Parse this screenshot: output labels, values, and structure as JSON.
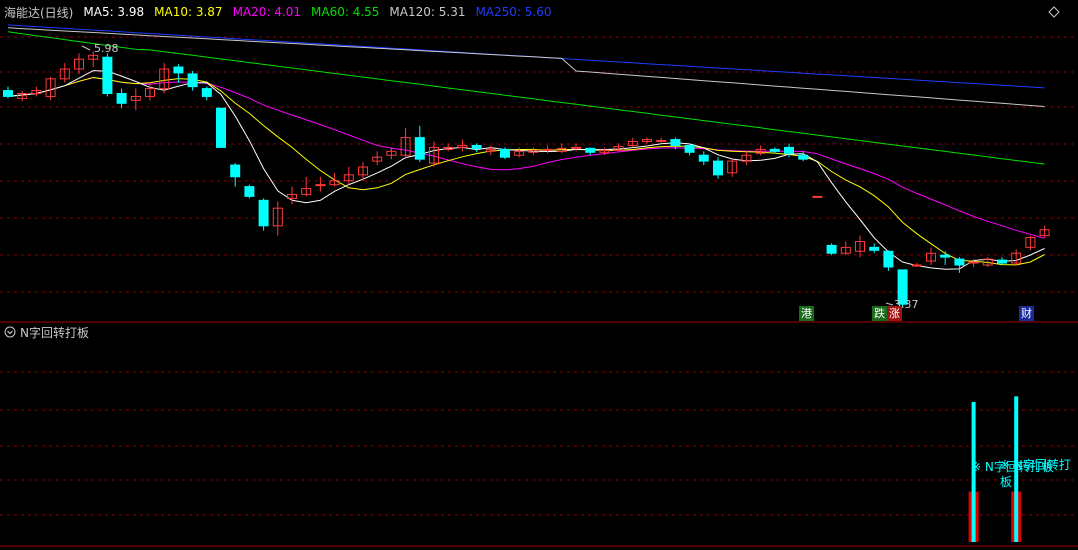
{
  "legend": {
    "title": "海能达(日线)",
    "items": [
      {
        "label": "MA5: 3.98",
        "color": "#ffffff"
      },
      {
        "label": "MA10: 3.87",
        "color": "#ffff00"
      },
      {
        "label": "MA20: 4.01",
        "color": "#ff00ff"
      },
      {
        "label": "MA60: 4.55",
        "color": "#00e000"
      },
      {
        "label": "MA120: 5.31",
        "color": "#c8c8c8"
      },
      {
        "label": "MA250: 5.60",
        "color": "#1e3cff"
      }
    ]
  },
  "annotations": {
    "high_label": "5.98",
    "low_label": "3.37"
  },
  "badges": [
    {
      "text": "港",
      "color": "#1a6b1a"
    },
    {
      "text": "跌",
      "color": "#1a6b1a"
    },
    {
      "text": "涨",
      "color": "#a01010"
    },
    {
      "text": "财",
      "color": "#1a2a9a"
    }
  ],
  "sub_panel": {
    "title": "N字回转打板",
    "signal_label": "※ N字回转打板",
    "signal_label_2": "※ N字回转打板"
  },
  "colors": {
    "up": "#ff3a3a",
    "down": "#00ffff",
    "grid": "#8b0000",
    "ma5": "#ffffff",
    "ma10": "#ffff00",
    "ma20": "#ff00ff",
    "ma60": "#00e000",
    "ma120": "#c8c8c8",
    "ma250": "#1e3cff"
  },
  "chart_data": {
    "type": "candlestick",
    "price_range": [
      3.3,
      6.3
    ],
    "candles": [
      [
        5.58,
        5.52,
        5.62,
        5.5
      ],
      [
        5.5,
        5.55,
        5.58,
        5.47
      ],
      [
        5.55,
        5.58,
        5.62,
        5.52
      ],
      [
        5.52,
        5.7,
        5.72,
        5.48
      ],
      [
        5.7,
        5.8,
        5.86,
        5.66
      ],
      [
        5.8,
        5.9,
        5.96,
        5.75
      ],
      [
        5.9,
        5.94,
        5.98,
        5.82
      ],
      [
        5.92,
        5.55,
        5.96,
        5.52
      ],
      [
        5.55,
        5.45,
        5.6,
        5.4
      ],
      [
        5.48,
        5.52,
        5.6,
        5.38
      ],
      [
        5.52,
        5.6,
        5.66,
        5.48
      ],
      [
        5.6,
        5.8,
        5.86,
        5.55
      ],
      [
        5.82,
        5.76,
        5.85,
        5.66
      ],
      [
        5.75,
        5.62,
        5.78,
        5.58
      ],
      [
        5.6,
        5.52,
        5.62,
        5.48
      ],
      [
        5.4,
        5.0,
        5.4,
        5.0
      ],
      [
        4.82,
        4.7,
        4.84,
        4.6
      ],
      [
        4.6,
        4.5,
        4.62,
        4.48
      ],
      [
        4.46,
        4.2,
        4.48,
        4.15
      ],
      [
        4.2,
        4.38,
        4.45,
        4.1
      ],
      [
        4.48,
        4.52,
        4.6,
        4.42
      ],
      [
        4.52,
        4.58,
        4.7,
        4.5
      ],
      [
        4.62,
        4.62,
        4.7,
        4.55
      ],
      [
        4.62,
        4.66,
        4.74,
        4.6
      ],
      [
        4.66,
        4.72,
        4.8,
        4.62
      ],
      [
        4.72,
        4.8,
        4.85,
        4.66
      ],
      [
        4.86,
        4.9,
        4.96,
        4.82
      ],
      [
        4.92,
        4.96,
        5.0,
        4.88
      ],
      [
        4.92,
        5.1,
        5.2,
        4.88
      ],
      [
        5.1,
        4.88,
        5.22,
        4.85
      ],
      [
        4.84,
        5.0,
        5.06,
        4.8
      ],
      [
        4.98,
        5.0,
        5.04,
        4.96
      ],
      [
        5.0,
        5.02,
        5.08,
        4.96
      ],
      [
        5.02,
        4.99,
        5.04,
        4.95
      ],
      [
        4.96,
        4.98,
        5.02,
        4.92
      ],
      [
        4.98,
        4.9,
        5.0,
        4.88
      ],
      [
        4.92,
        4.96,
        5.0,
        4.9
      ],
      [
        4.95,
        4.97,
        5.0,
        4.92
      ],
      [
        4.97,
        4.98,
        5.02,
        4.94
      ],
      [
        4.96,
        4.99,
        5.04,
        4.94
      ],
      [
        5.0,
        5.0,
        5.04,
        4.96
      ],
      [
        4.99,
        4.95,
        5.0,
        4.92
      ],
      [
        4.95,
        4.97,
        5.0,
        4.92
      ],
      [
        4.97,
        5.01,
        5.04,
        4.96
      ],
      [
        5.02,
        5.06,
        5.1,
        5.0
      ],
      [
        5.06,
        5.08,
        5.1,
        5.04
      ],
      [
        5.07,
        5.07,
        5.1,
        5.05
      ],
      [
        5.08,
        5.02,
        5.1,
        4.98
      ],
      [
        5.02,
        4.95,
        5.04,
        4.92
      ],
      [
        4.92,
        4.86,
        4.96,
        4.82
      ],
      [
        4.86,
        4.72,
        4.9,
        4.68
      ],
      [
        4.74,
        4.86,
        4.88,
        4.7
      ],
      [
        4.86,
        4.92,
        4.96,
        4.82
      ],
      [
        4.94,
        4.98,
        5.02,
        4.92
      ],
      [
        4.98,
        4.96,
        5.0,
        4.94
      ],
      [
        5.0,
        4.94,
        5.04,
        4.9
      ],
      [
        4.92,
        4.88,
        4.96,
        4.86
      ],
      [
        4.5,
        4.5,
        4.5,
        4.5
      ],
      [
        4.0,
        3.92,
        4.02,
        3.9
      ],
      [
        3.92,
        3.98,
        4.04,
        3.9
      ],
      [
        3.94,
        4.04,
        4.1,
        3.88
      ],
      [
        3.98,
        3.95,
        4.02,
        3.92
      ],
      [
        3.94,
        3.78,
        3.95,
        3.74
      ],
      [
        3.75,
        3.4,
        3.75,
        3.37
      ],
      [
        3.8,
        3.8,
        3.82,
        3.78
      ],
      [
        3.84,
        3.92,
        3.98,
        3.8
      ],
      [
        3.9,
        3.88,
        3.94,
        3.8
      ],
      [
        3.86,
        3.8,
        3.88,
        3.72
      ],
      [
        3.82,
        3.83,
        3.86,
        3.78
      ],
      [
        3.8,
        3.86,
        3.88,
        3.78
      ],
      [
        3.85,
        3.82,
        3.88,
        3.8
      ],
      [
        3.82,
        3.92,
        3.96,
        3.8
      ],
      [
        3.98,
        4.08,
        4.1,
        3.95
      ],
      [
        4.1,
        4.16,
        4.2,
        4.08
      ]
    ],
    "signals": [
      {
        "index": 68,
        "cyan_value": 1.0,
        "red_value": 0.48
      },
      {
        "index": 71,
        "cyan_value": 1.04,
        "red_value": 0.48
      }
    ]
  }
}
